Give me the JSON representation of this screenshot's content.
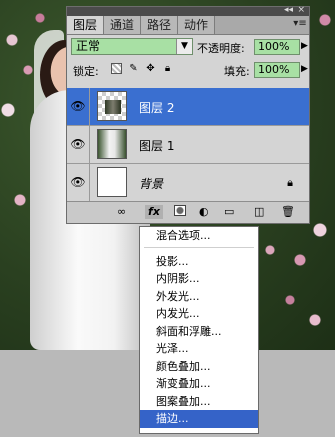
{
  "tabs": [
    "图层",
    "通道",
    "路径",
    "动作"
  ],
  "panel_controls": {
    "collapse": "◂◂",
    "close": "×",
    "menu": "▾≡"
  },
  "blend_mode": "正常",
  "opacity_label": "不透明度:",
  "opacity_value": "100%",
  "lock_label": "锁定:",
  "fill_label": "填充:",
  "fill_value": "100%",
  "layers": [
    {
      "name": "图层 2",
      "selected": true,
      "visible": true,
      "locked": false
    },
    {
      "name": "图层 1",
      "selected": false,
      "visible": true,
      "locked": false
    },
    {
      "name": "背景",
      "selected": false,
      "visible": true,
      "locked": true
    }
  ],
  "footer_icons": [
    "link-icon",
    "fx-icon",
    "mask-icon",
    "adjustment-icon",
    "folder-icon",
    "new-layer-icon",
    "trash-icon"
  ],
  "footer_fx_label": "fx",
  "menu": {
    "items": [
      {
        "label": "混合选项...",
        "separator_after": true
      },
      {
        "label": "投影..."
      },
      {
        "label": "内阴影..."
      },
      {
        "label": "外发光..."
      },
      {
        "label": "内发光..."
      },
      {
        "label": "斜面和浮雕..."
      },
      {
        "label": "光泽..."
      },
      {
        "label": "颜色叠加..."
      },
      {
        "label": "渐变叠加..."
      },
      {
        "label": "图案叠加..."
      },
      {
        "label": "描边...",
        "selected": true
      }
    ]
  },
  "colors": {
    "selection": "#3a6fd0",
    "menu_highlight": "#3563c8",
    "field_green": "#a8e0a4"
  }
}
